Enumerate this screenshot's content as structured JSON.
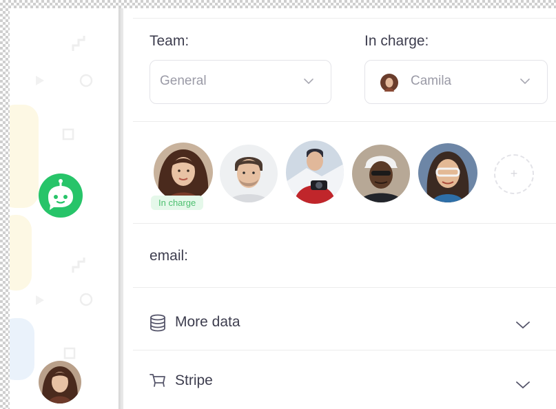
{
  "team_field": {
    "label": "Team:",
    "value": "General",
    "icon": "chevron-down-icon"
  },
  "in_charge_field": {
    "label": "In charge:",
    "value": "Camila",
    "icon": "chevron-down-icon"
  },
  "team_members": {
    "in_charge_badge": "In charge",
    "add_icon": "plus-icon"
  },
  "email_row": {
    "label": "email:"
  },
  "more_data_row": {
    "label": "More data",
    "icon": "database-icon"
  },
  "stripe_row": {
    "label": "Stripe",
    "icon": "cart-icon"
  },
  "colors": {
    "accent_green": "#27c469",
    "badge_bg": "#e5f8ea",
    "text": "#3d3d4e",
    "muted": "#9a9aa6"
  }
}
